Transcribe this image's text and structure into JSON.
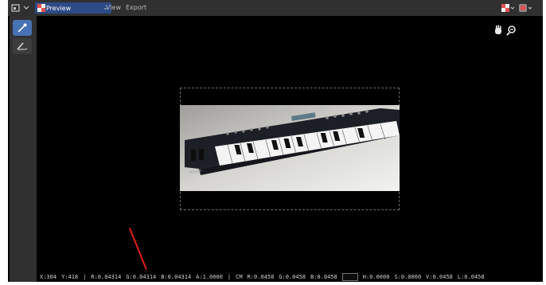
{
  "header": {
    "editor_type_icon": "image-editor-icon",
    "mode_icon": "checker-preview-icon",
    "mode_label": "Preview",
    "menu": [
      "View",
      "Export"
    ]
  },
  "toolbar": {
    "tools": [
      {
        "name": "sample-tool",
        "icon": "eyedropper-icon",
        "active": true
      },
      {
        "name": "annotate-tool",
        "icon": "annotate-pen-icon",
        "active": false
      }
    ]
  },
  "navigation": {
    "pan_icon": "hand-icon",
    "zoom_icon": "zoom-icon"
  },
  "image": {
    "subject": "MIDI keyboard photo",
    "brand_text": "Axiom"
  },
  "status": {
    "x": "X:304",
    "y": "Y:418",
    "sep1": "|",
    "r": "R:0.04314",
    "g": "G:0.04314",
    "b": "B:0.04314",
    "a": "A:1.0000",
    "sep2": "|",
    "cm": "CM",
    "cm_r": "R:0.0458",
    "cm_g": "G:0.0458",
    "cm_b": "B:0.0458",
    "h": "H:0.0000",
    "s": "S:0.0000",
    "v": "V:0.0458",
    "l": "L:0.0458"
  },
  "colors": {
    "header_bg": "#303030",
    "accent": "#4772b3",
    "mode_dropdown": "#2c4a86",
    "canvas_bg": "#000000",
    "annotation": "#e0201a"
  }
}
